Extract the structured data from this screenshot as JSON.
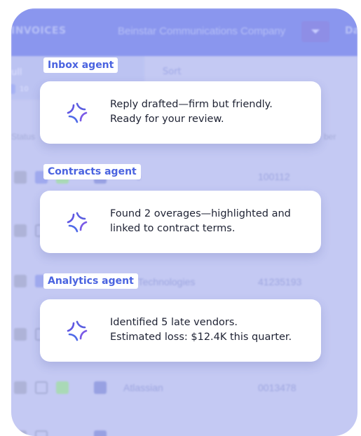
{
  "app": {
    "section_title": "INVOICES",
    "company_name": "Beinstar Communications Company",
    "right_cut_label": "Da",
    "filter_tab_label": "ull",
    "filter_tab_count": "10",
    "sort_label": "Sort",
    "columns": {
      "status": "Status",
      "number": "ber"
    },
    "rows": [
      {
        "vendor": "e",
        "number": "100112"
      },
      {
        "vendor": "",
        "number": ""
      },
      {
        "vendor": "k Technologies",
        "number": "41235193"
      },
      {
        "vendor": "",
        "number": ""
      },
      {
        "vendor": "Atlassian",
        "number": "0013478"
      }
    ]
  },
  "agents": [
    {
      "tag": "Inbox agent",
      "lines": [
        "Reply drafted—firm but friendly.",
        "Ready for your review."
      ],
      "icon": "ai-sparkle-icon"
    },
    {
      "tag": "Contracts agent",
      "lines": [
        "Found 2 overages—highlighted and",
        "linked to contract terms."
      ],
      "icon": "ai-sparkle-icon"
    },
    {
      "tag": "Analytics agent",
      "lines": [
        "Identified 5 late vendors.",
        "Estimated loss: $12.4K this quarter."
      ],
      "icon": "ai-sparkle-icon"
    }
  ],
  "colors": {
    "accent": "#4a63e0",
    "overlay": "#c4c9f3",
    "topbar": "#8a96ee"
  }
}
